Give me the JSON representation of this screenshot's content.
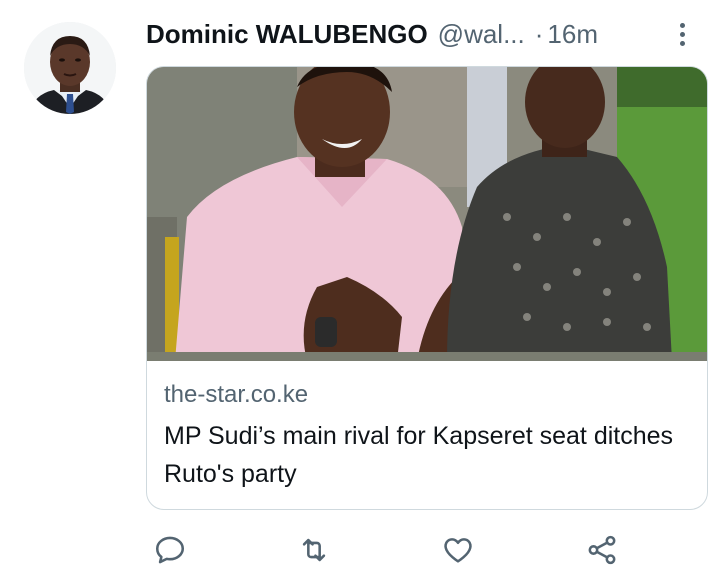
{
  "tweet": {
    "author_name": "Dominic WALUBENGO",
    "handle": "@wal...",
    "separator": "·",
    "time": "16m"
  },
  "link_card": {
    "domain": "the-star.co.ke",
    "title": "MP Sudi’s main rival for Kapseret seat ditches Ruto's party"
  },
  "actions": {
    "reply_icon": "reply-icon",
    "retweet_icon": "retweet-icon",
    "like_icon": "heart-icon",
    "share_icon": "share-icon"
  },
  "colors": {
    "text_primary": "#0f1419",
    "text_secondary": "#536471",
    "border": "#cfd9de",
    "icon": "#536471"
  }
}
